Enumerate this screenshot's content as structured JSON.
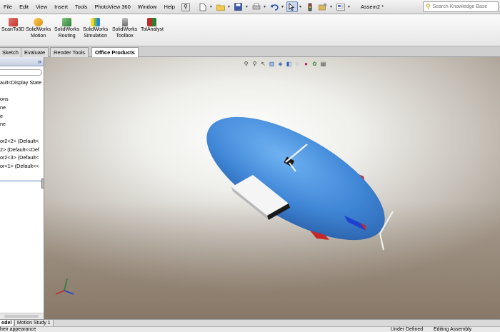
{
  "menu": {
    "items": [
      "File",
      "Edit",
      "View",
      "Insert",
      "Tools",
      "PhotoView 360",
      "Window",
      "Help"
    ],
    "pin_glyph": "⚲"
  },
  "standard_toolbar": {
    "icons": [
      "new-document-icon",
      "open-folder-icon",
      "save-icon",
      "print-icon",
      "undo-icon",
      "select-arrow-icon",
      "traffic-light-icon",
      "options-icon",
      "file-properties-icon"
    ]
  },
  "document": {
    "title": "Assem2 *"
  },
  "search": {
    "placeholder": "Search Knowledge Base",
    "icon": "knowledge-base-icon"
  },
  "command_manager": {
    "buttons": [
      {
        "label": "ScanTo3D",
        "icon": "scanto3d-icon",
        "color": "#c0392b"
      },
      {
        "label": "SolidWorks\nMotion",
        "icon": "motion-icon",
        "color": "#d98e04"
      },
      {
        "label": "SolidWorks\nRouting",
        "icon": "routing-icon",
        "color": "#2e7d32"
      },
      {
        "label": "SolidWorks\nSimulation",
        "icon": "simulation-icon",
        "color": "#7cb342"
      },
      {
        "label": "SolidWorks\nToolbox",
        "icon": "toolbox-icon",
        "color": "#6d6d6d"
      },
      {
        "label": "TolAnalyst",
        "icon": "tolanalyst-icon",
        "color": "#c62828"
      }
    ]
  },
  "tabs": [
    "Sketch",
    "Evaluate",
    "Render Tools",
    "Office Products"
  ],
  "active_tab": "Office Products",
  "feature_tree": {
    "items": [
      "ault<Display State",
      "",
      "ons",
      "ne",
      "e",
      "ne",
      "",
      "or2<2> (Default<",
      "2> (Default<<Def",
      "or2<3> (Default<",
      "or<1> (Default<<"
    ],
    "collapse_glyph": "»"
  },
  "heads_up_toolbar": {
    "icons": [
      "zoom-to-fit-icon",
      "zoom-to-area-icon",
      "previous-view-icon",
      "section-view-icon",
      "view-orientation-icon",
      "display-style-icon",
      "hide-show-items-icon",
      "edit-appearance-icon",
      "apply-scene-icon",
      "view-settings-icon"
    ]
  },
  "bottom_tabs": [
    "odel",
    "Motion Study 1"
  ],
  "active_bottom_tab": "odel",
  "status": {
    "message": "heir appearance",
    "state": "Under Defined",
    "mode": "Editing Assembly"
  },
  "colors": {
    "blimp_body": "#3f86d6",
    "fin_red": "#c62828",
    "fin_blue": "#1f3fd0",
    "selection_border": "#6b86b4"
  }
}
